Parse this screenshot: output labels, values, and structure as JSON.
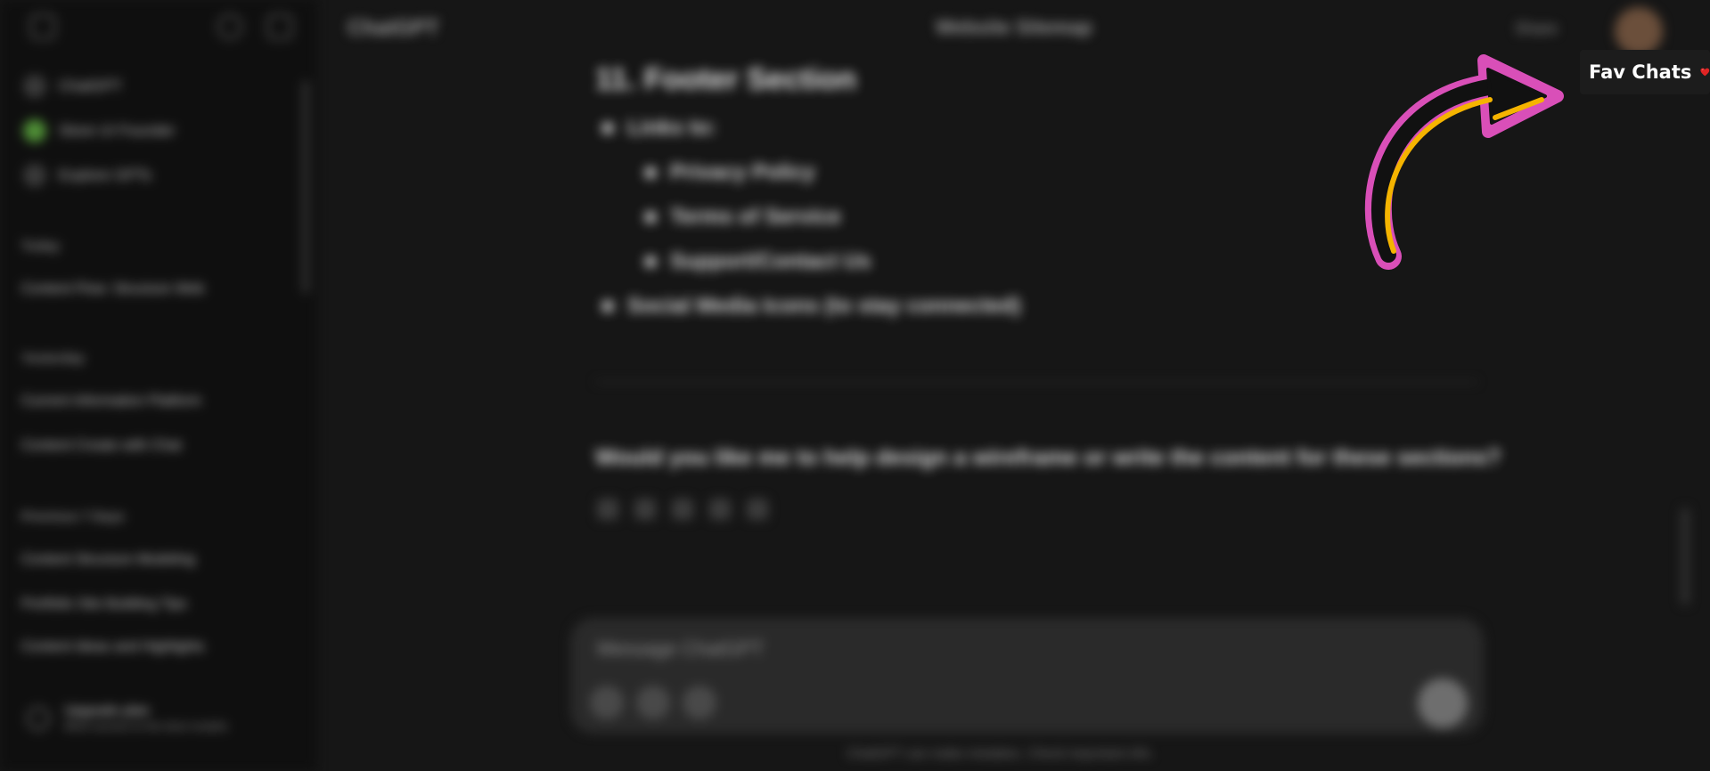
{
  "sidebar": {
    "nav": [
      {
        "label": "ChatGPT",
        "icon": "chatgpt-logo-icon"
      },
      {
        "label": "Store UI Founder",
        "icon": "green-avatar-icon"
      },
      {
        "label": "Explore GPTs",
        "icon": "grid-icon"
      }
    ],
    "sections": [
      {
        "title": "Today",
        "items": [
          "Content Flow: Structure Web"
        ]
      },
      {
        "title": "Yesterday",
        "items": [
          "Current Information Platform",
          "Content Create with Chat"
        ]
      },
      {
        "title": "Previous 7 Days",
        "items": [
          "Content Structure Modeling",
          "Portfolio Site Building Tips",
          "Content Ideas and Highlights"
        ]
      }
    ],
    "upgrade": {
      "title": "Upgrade plan",
      "subtitle": "More access to the best models"
    }
  },
  "topbar": {
    "model": "ChatGPT",
    "title": "Website Sitemap",
    "share": "Share"
  },
  "content": {
    "heading": "11. Footer Section",
    "bullets": [
      {
        "level": 0,
        "text": "Links to:"
      },
      {
        "level": 1,
        "text": "Privacy Policy"
      },
      {
        "level": 1,
        "text": "Terms of Service"
      },
      {
        "level": 1,
        "text": "Support/Contact Us"
      },
      {
        "level": 0,
        "text": "Social Media Icons (to stay connected)"
      }
    ],
    "question": "Would you like me to help design a wireframe or write the content for these sections?"
  },
  "composer": {
    "placeholder": "Message ChatGPT"
  },
  "disclaimer": "ChatGPT can make mistakes. Check important info.",
  "overlay": {
    "fav_label": "Fav Chats",
    "heart_icon": "heart-icon",
    "arrow_icon": "curved-arrow-icon",
    "colors": {
      "arrow_outline": "#d94fb8",
      "arrow_fill": "#111111",
      "arrow_highlight": "#f5b400",
      "heart": "#e02424"
    }
  }
}
